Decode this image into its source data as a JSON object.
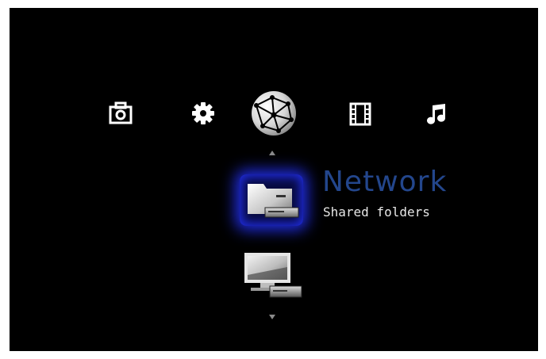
{
  "categories": [
    {
      "id": "photo",
      "icon": "camera-icon",
      "selected": false
    },
    {
      "id": "settings",
      "icon": "gear-icon",
      "selected": false
    },
    {
      "id": "network",
      "icon": "globe-icon",
      "selected": true
    },
    {
      "id": "video",
      "icon": "film-icon",
      "selected": false
    },
    {
      "id": "music",
      "icon": "music-note-icon",
      "selected": false
    }
  ],
  "selected_item": {
    "title": "Network",
    "subtitle": "Shared folders",
    "icon": "network-folder-icon"
  },
  "next_item": {
    "icon": "network-computer-icon"
  },
  "colors": {
    "background": "#000000",
    "title": "#23468c",
    "highlight_glow": "#1f2bd8",
    "subtitle": "#e8e8e8"
  }
}
